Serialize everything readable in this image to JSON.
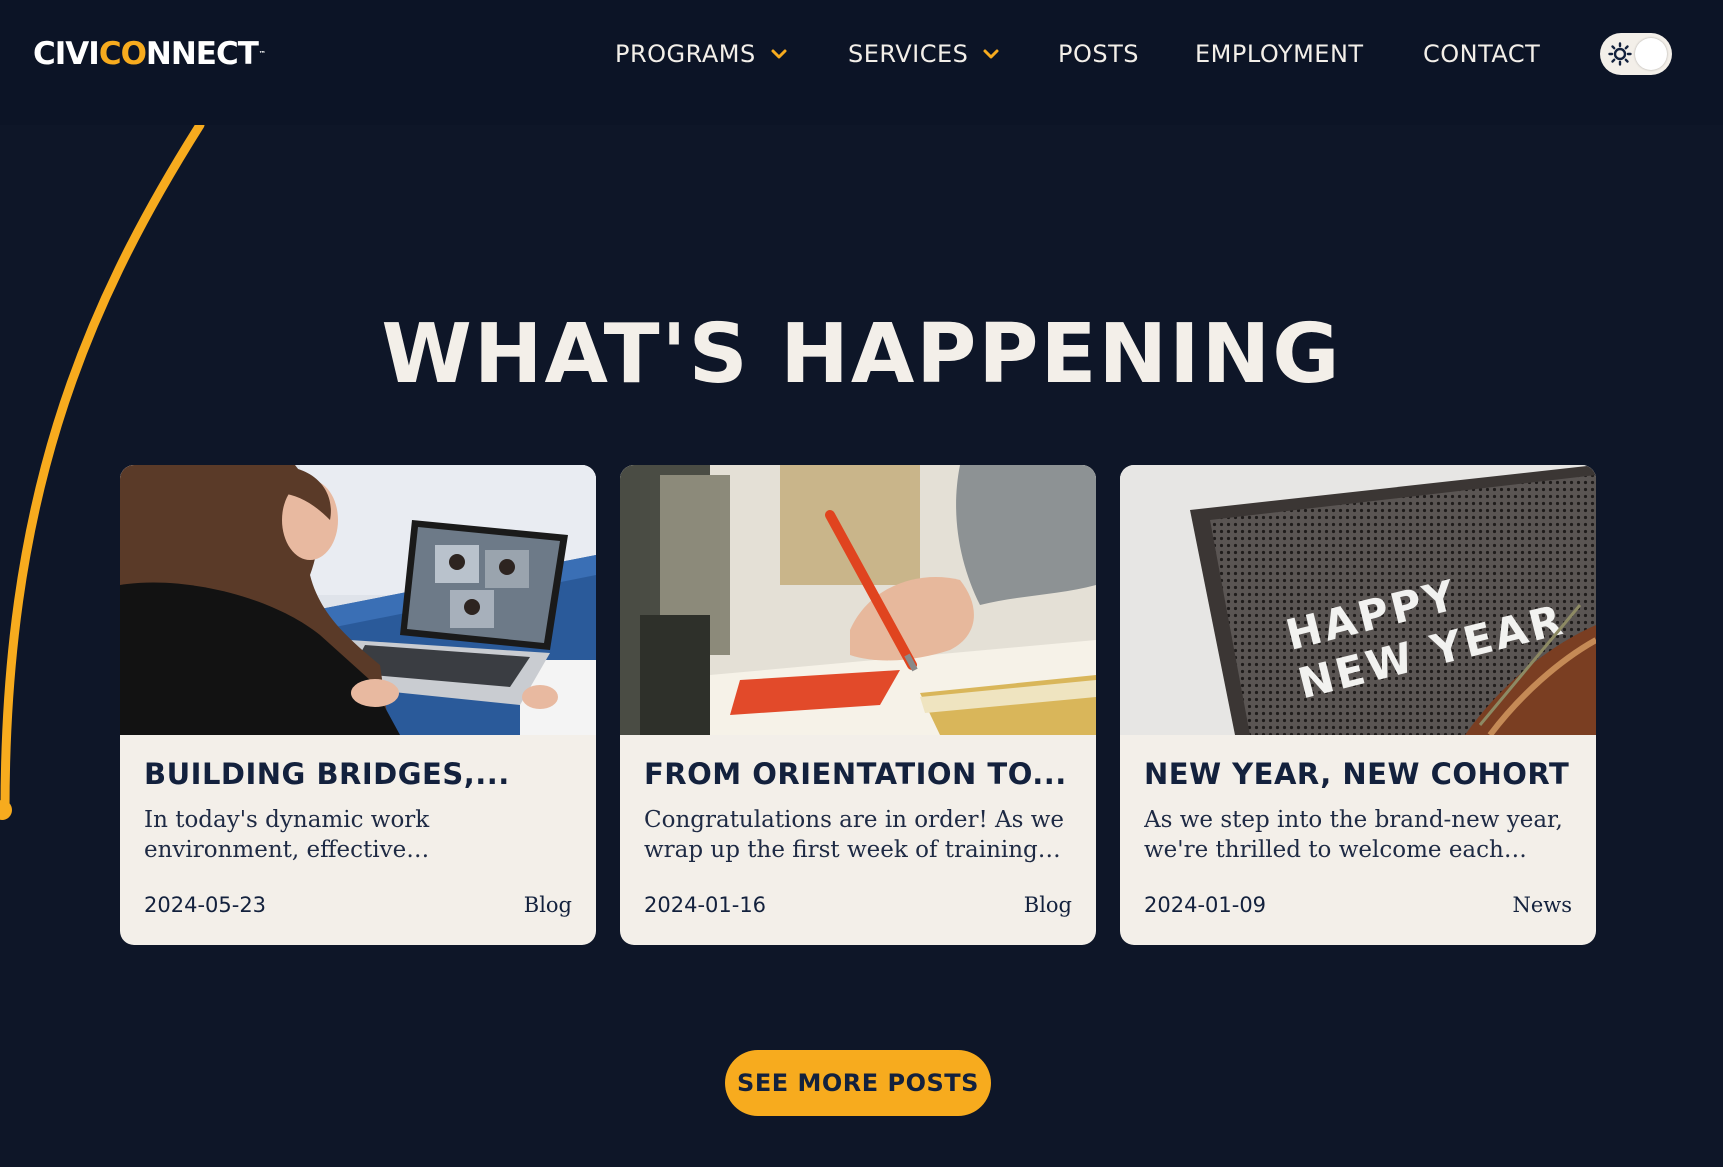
{
  "brand": {
    "logo_part1": "CIVI",
    "logo_accent": "CO",
    "logo_part2": "NNECT",
    "logo_tm": "™",
    "accent_color": "#f7ab1e",
    "background_color": "#0e1628"
  },
  "nav": {
    "items": [
      {
        "label": "PROGRAMS",
        "has_dropdown": true
      },
      {
        "label": "SERVICES",
        "has_dropdown": true
      },
      {
        "label": "POSTS",
        "has_dropdown": false
      },
      {
        "label": "EMPLOYMENT",
        "has_dropdown": false
      },
      {
        "label": "CONTACT",
        "has_dropdown": false
      }
    ],
    "theme_toggle_icon": "sun-icon"
  },
  "section": {
    "heading": "WHAT'S HAPPENING"
  },
  "posts": [
    {
      "title": "BUILDING BRIDGES,...",
      "excerpt": "In today's dynamic work environment, effective communication is the...",
      "date": "2024-05-23",
      "category": "Blog",
      "image": "woman-video-call-laptop"
    },
    {
      "title": "FROM ORIENTATION TO...",
      "excerpt": "Congratulations are in order! As we wrap up the first week of training for...",
      "date": "2024-01-16",
      "category": "Blog",
      "image": "hand-writing-notebook"
    },
    {
      "title": "NEW YEAR, NEW COHORT",
      "excerpt": "As we step into the brand-new year, we're thrilled to welcome each and...",
      "date": "2024-01-09",
      "category": "News",
      "image": "happy-new-year-letterboard"
    }
  ],
  "cta": {
    "label": "SEE MORE POSTS"
  }
}
